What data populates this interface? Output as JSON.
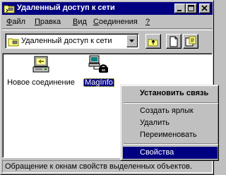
{
  "window": {
    "title": "Удаленный доступ к сети",
    "title_icon": "dialup-folder-icon",
    "controls": [
      "minimize-icon",
      "maximize-icon",
      "close-icon"
    ]
  },
  "menubar": {
    "items": [
      {
        "underlined": "Ф",
        "rest": "айл"
      },
      {
        "underlined": "П",
        "rest": "равка"
      },
      {
        "underlined": "В",
        "rest": "ид"
      },
      {
        "underlined": "С",
        "rest": "оединения"
      },
      {
        "underlined": "?",
        "rest": ""
      }
    ]
  },
  "toolbar": {
    "address_value": "Удаленный доступ к сети",
    "buttons": [
      "up-folder-icon",
      "new-connection-icon",
      "properties-icon"
    ]
  },
  "content": {
    "items": [
      {
        "label": "Новое соединение",
        "icon": "new-connection-wizard-icon",
        "selected": false
      },
      {
        "label": "MagInfo",
        "icon": "dialup-computer-icon",
        "selected": true
      }
    ]
  },
  "context_menu": {
    "items": [
      {
        "label": "Установить связь",
        "bold": true
      },
      {
        "label": "Создать ярлык"
      },
      {
        "label": "Удалить"
      },
      {
        "label": "Переименовать"
      },
      {
        "label": "Свойства",
        "highlighted": true
      }
    ]
  },
  "status": {
    "text": "Обращение к окнам свойств выделенных объектов."
  },
  "colors": {
    "titlebar": "#000080",
    "face": "#c0c0c0",
    "selection": "#000080"
  }
}
